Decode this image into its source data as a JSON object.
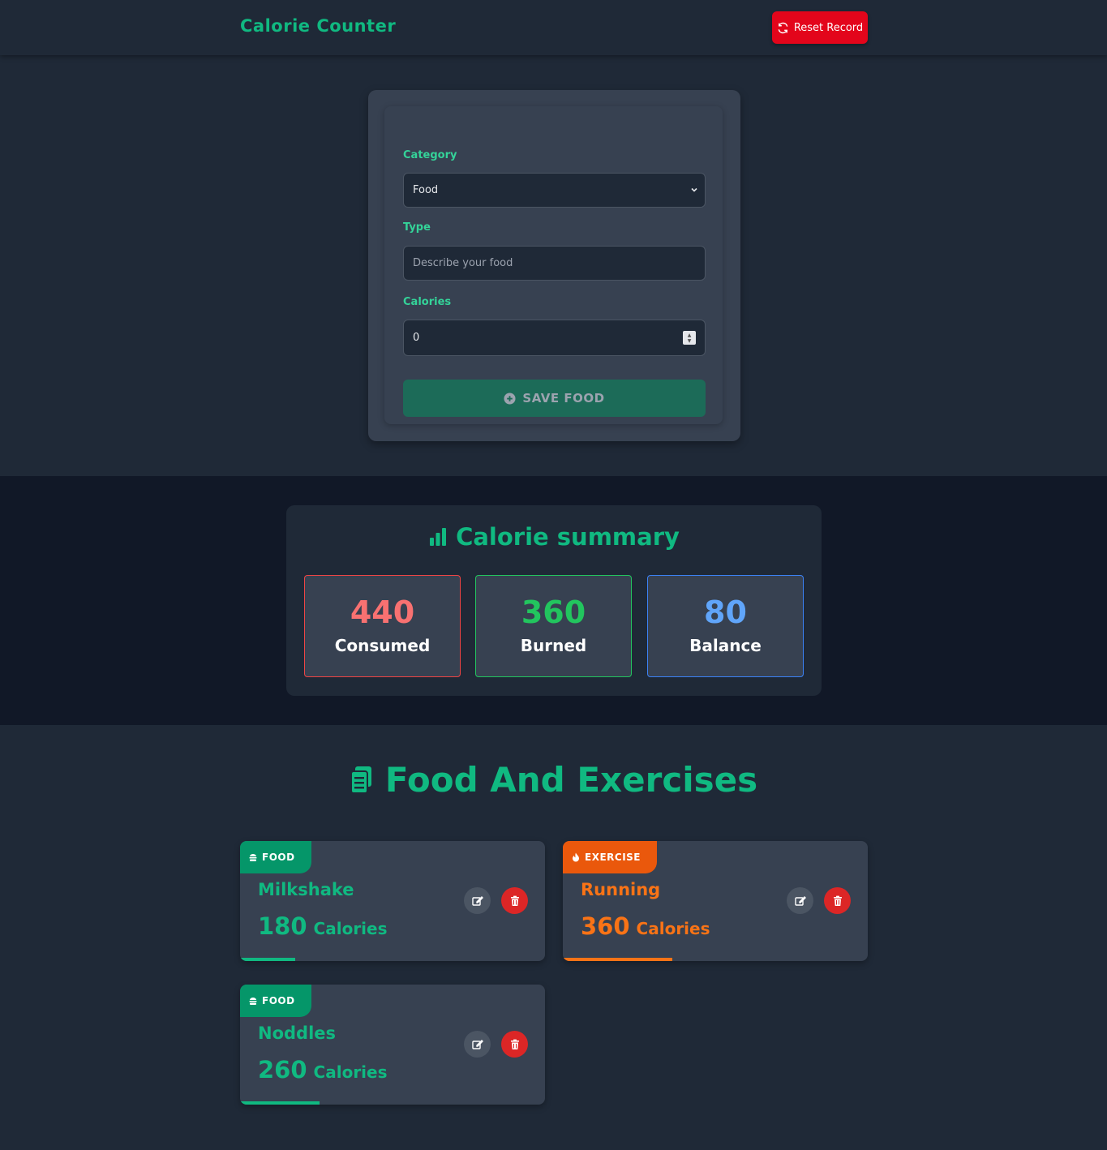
{
  "header": {
    "brand": "Calorie Counter",
    "reset_label": "Reset Record"
  },
  "form": {
    "category_label": "Category",
    "category_value": "Food",
    "type_label": "Type",
    "type_placeholder": "Describe your food",
    "calories_label": "Calories",
    "calories_value": "0",
    "save_label": "SAVE FOOD"
  },
  "summary": {
    "title": "Calorie summary",
    "consumed": {
      "value": "440",
      "label": "Consumed"
    },
    "burned": {
      "value": "360",
      "label": "Burned"
    },
    "balance": {
      "value": "80",
      "label": "Balance"
    }
  },
  "list": {
    "title": "Food And Exercises",
    "calories_unit": "Calories",
    "items": [
      {
        "category": "FOOD",
        "name": "Milkshake",
        "calories": "180",
        "progress": 0.18
      },
      {
        "category": "EXERCISE",
        "name": "Running",
        "calories": "360",
        "progress": 0.36
      },
      {
        "category": "FOOD",
        "name": "Noddles",
        "calories": "260",
        "progress": 0.26
      }
    ]
  },
  "colors": {
    "accent": "#10b981",
    "danger": "#e3051b",
    "exercise": "#f97316",
    "balance": "#60a5fa"
  }
}
